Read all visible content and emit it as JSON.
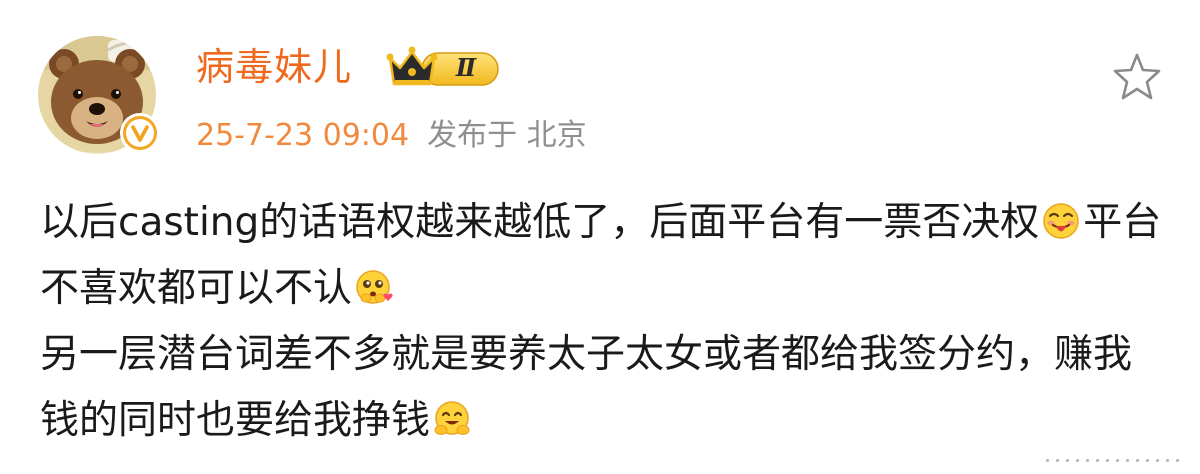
{
  "post": {
    "author": {
      "name": "病毒妹儿",
      "level_badge": "Ⅱ",
      "verified": true
    },
    "meta": {
      "timestamp": "25-7-23 09:04",
      "location": "发布于 北京"
    },
    "content": {
      "line1_text1": "以后casting的话语权越来越低了，后面平台有一票否决权",
      "line1_text2": "平台不喜欢都可以不认",
      "line2_text1": "另一层潜台词差不多就是要养太子太女或者都给我签分约，赚我钱的同时也要给我挣钱",
      "emojis": [
        "tongue-out-emoji",
        "pleading-hearts-emoji",
        "hug-smile-emoji"
      ]
    }
  },
  "colors": {
    "username": "#ef6a1e",
    "timestamp": "#f08a3e",
    "location": "#8f8f8f",
    "verified_badge": "#f5a623",
    "text": "#1a1a1a"
  },
  "icons": {
    "favorite": "star-outline-icon",
    "more": "more-dots-icon"
  }
}
